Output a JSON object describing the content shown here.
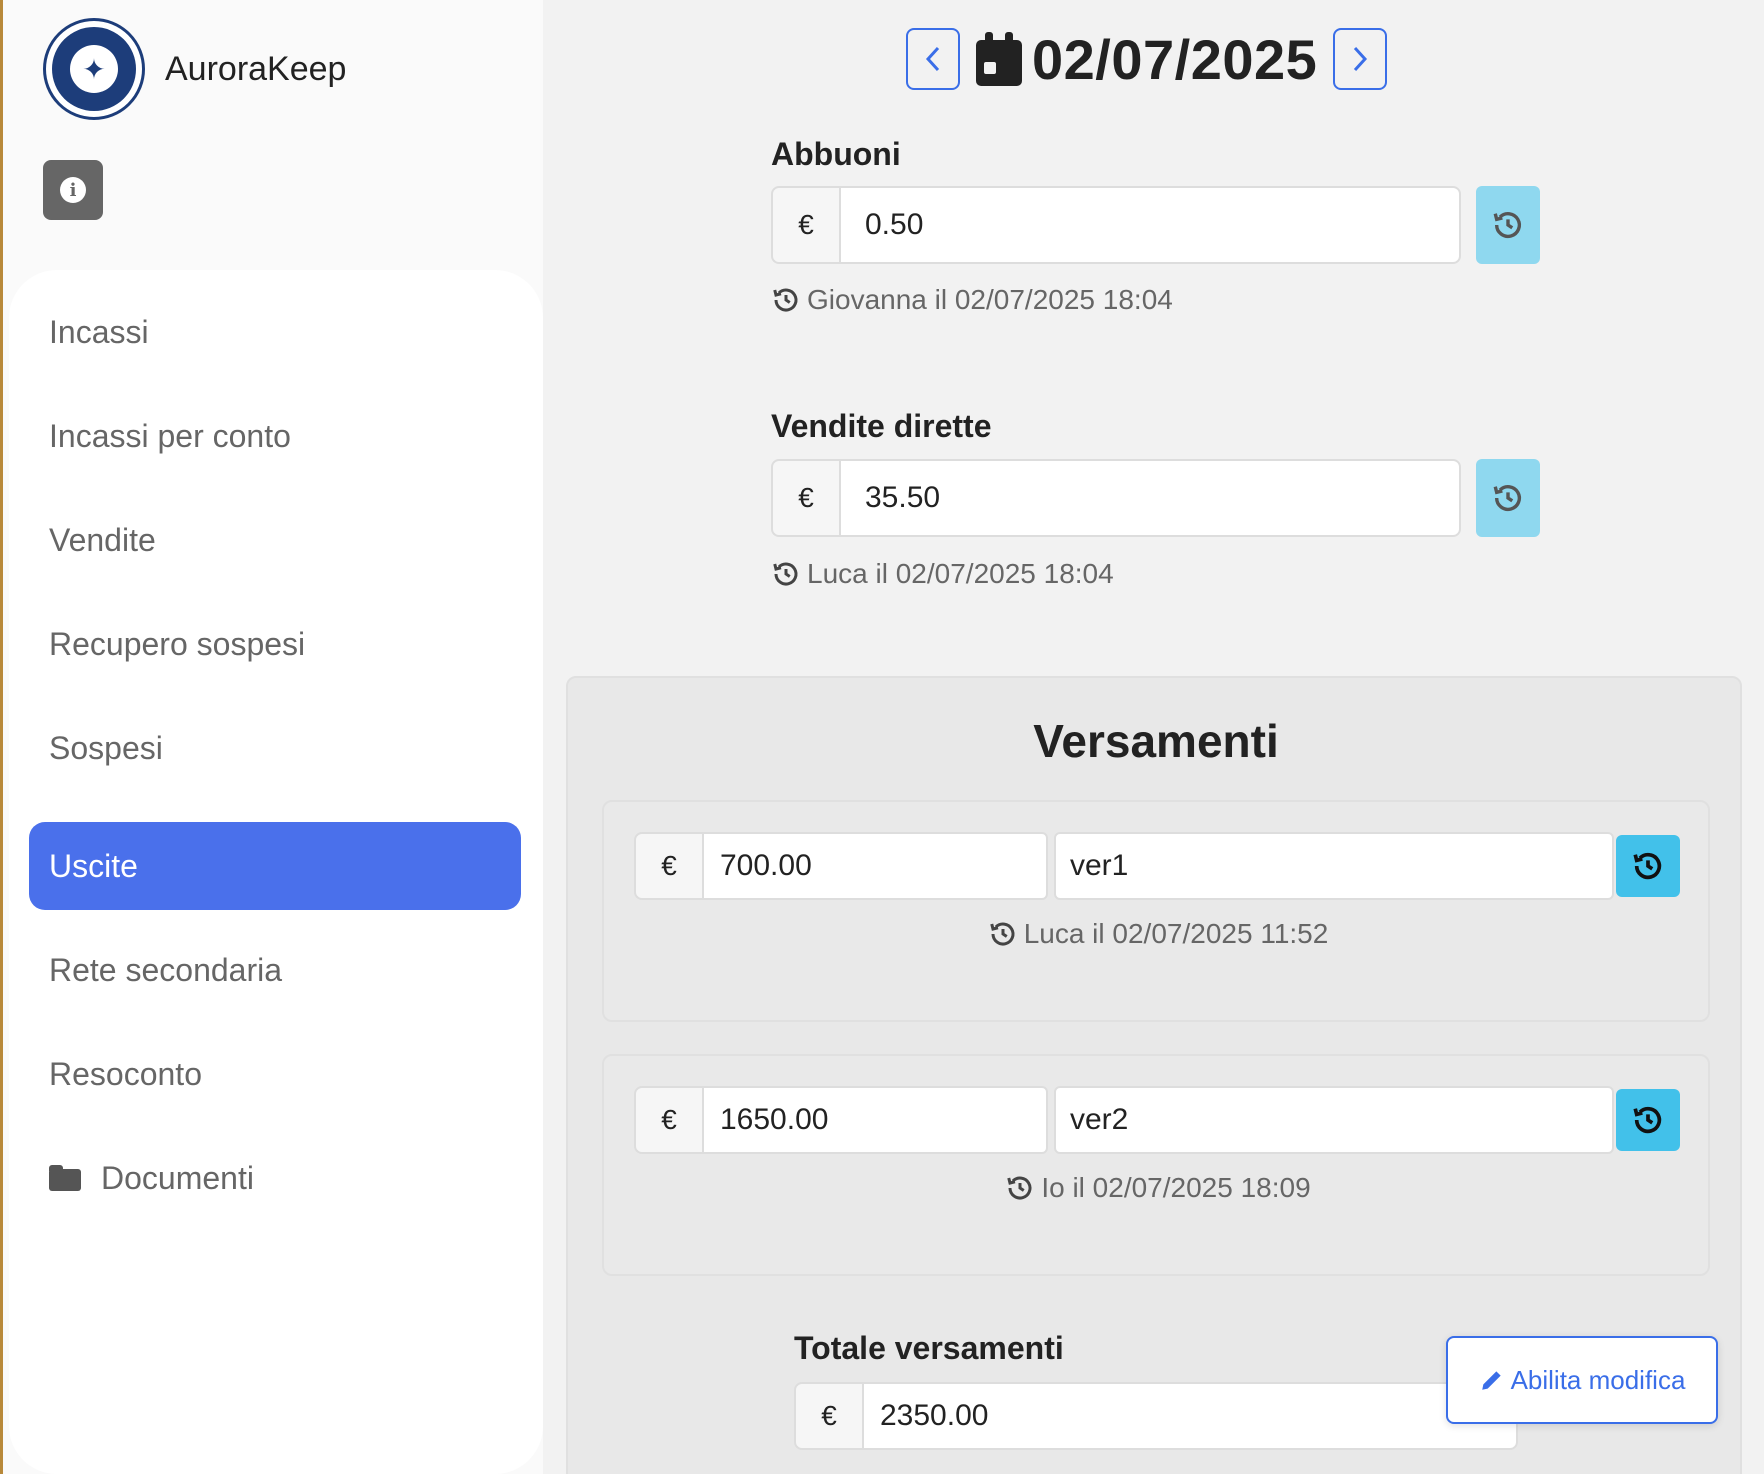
{
  "brand": {
    "name": "AuroraKeep"
  },
  "sidebar": {
    "items": [
      {
        "label": "Incassi"
      },
      {
        "label": "Incassi per conto"
      },
      {
        "label": "Vendite"
      },
      {
        "label": "Recupero sospesi"
      },
      {
        "label": "Sospesi"
      },
      {
        "label": "Uscite",
        "active": true
      },
      {
        "label": "Rete secondaria"
      },
      {
        "label": "Resoconto"
      },
      {
        "label": "Documenti",
        "icon": "folder-icon"
      }
    ]
  },
  "date_nav": {
    "prev_icon": "chevron-left-icon",
    "date": "02/07/2025",
    "next_icon": "chevron-right-icon",
    "calendar_icon": "calendar-icon"
  },
  "abbuoni": {
    "label": "Abbuoni",
    "currency": "€",
    "value": "0.50",
    "meta": "Giovanna il 02/07/2025 18:04"
  },
  "vendite_dirette": {
    "label": "Vendite dirette",
    "currency": "€",
    "value": "35.50",
    "meta": "Luca il 02/07/2025 18:04"
  },
  "versamenti": {
    "title": "Versamenti",
    "rows": [
      {
        "currency": "€",
        "amount": "700.00",
        "description": "ver1",
        "meta": "Luca il 02/07/2025 11:52"
      },
      {
        "currency": "€",
        "amount": "1650.00",
        "description": "ver2",
        "meta": "Io il 02/07/2025 18:09"
      }
    ],
    "totale_label": "Totale versamenti",
    "totale_currency": "€",
    "totale_value": "2350.00"
  },
  "actions": {
    "enable_edit": "Abilita modifica"
  },
  "colors": {
    "accent": "#4a70eb",
    "history_button": "#42c1ea",
    "link": "#3a6ee8"
  }
}
